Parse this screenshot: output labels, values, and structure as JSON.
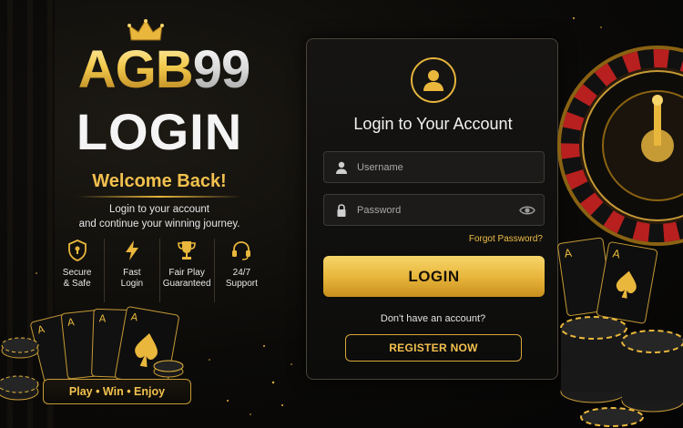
{
  "brand": {
    "logo_prefix": "AGB",
    "logo_suffix": "99",
    "page_heading": "LOGIN",
    "welcome": "Welcome Back!",
    "subtext_line1": "Login to your account",
    "subtext_line2": "and continue your winning journey.",
    "tagline": "Play • Win • Enjoy"
  },
  "features": [
    {
      "icon": "shield-check-icon",
      "label": "Secure\n& Safe"
    },
    {
      "icon": "lightning-icon",
      "label": "Fast\nLogin"
    },
    {
      "icon": "trophy-icon",
      "label": "Fair Play\nGuaranteed"
    },
    {
      "icon": "headset-icon",
      "label": "24/7\nSupport"
    }
  ],
  "login_panel": {
    "title": "Login to Your Account",
    "username_placeholder": "Username",
    "password_placeholder": "Password",
    "forgot_password": "Forgot Password?",
    "login_button": "LOGIN",
    "no_account_text": "Don't have an account?",
    "register_button": "REGISTER NOW"
  },
  "colors": {
    "gold": "#f2c14e",
    "background": "#0b0a08",
    "panel": "#161513"
  }
}
